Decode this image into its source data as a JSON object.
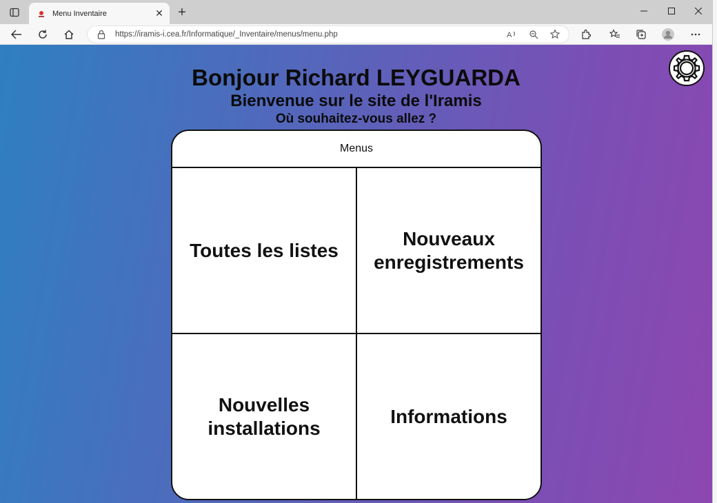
{
  "browser": {
    "tab_title": "Menu Inventaire",
    "tab_close": "✕",
    "new_tab": "+",
    "url": "https://iramis-i.cea.fr/Informatique/_Inventaire/menus/menu.php"
  },
  "page": {
    "greeting": "Bonjour Richard LEYGUARDA",
    "welcome": "Bienvenue sur le site de l'Iramis",
    "question": "Où souhaitez-vous allez ?",
    "menu": {
      "title": "Menus",
      "items": [
        {
          "label": "Toutes les listes"
        },
        {
          "label": "Nouveaux enregistrements"
        },
        {
          "label": "Nouvelles installations"
        },
        {
          "label": "Informations"
        }
      ]
    }
  },
  "colors": {
    "gradient_start": "#2f7fc1",
    "gradient_end": "#8d47b0"
  }
}
